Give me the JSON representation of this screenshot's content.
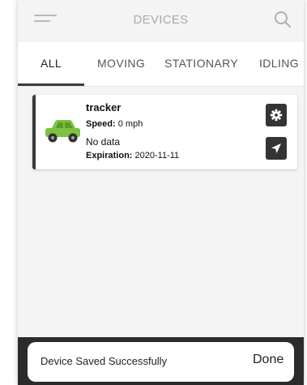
{
  "header": {
    "title": "DEVICES"
  },
  "tabs": [
    {
      "label": "ALL",
      "active": true
    },
    {
      "label": "MOVING",
      "active": false
    },
    {
      "label": "STATIONARY",
      "active": false
    },
    {
      "label": "IDLING",
      "active": false
    }
  ],
  "device": {
    "name": "tracker",
    "speed_label": "Speed:",
    "speed_value": "0 mph",
    "status": "No data",
    "expiration_label": "Expiration:",
    "expiration_value": "2020-11-11",
    "icon": "car-icon",
    "icon_color": "#7cc242"
  },
  "actions": {
    "settings_icon": "gear-icon",
    "send_icon": "navigation-arrow-icon"
  },
  "snackbar": {
    "message": "Device Saved Successfully",
    "action": "Done"
  },
  "colors": {
    "accent": "#343434",
    "background": "#f4f4f4",
    "car": "#7cc242"
  }
}
